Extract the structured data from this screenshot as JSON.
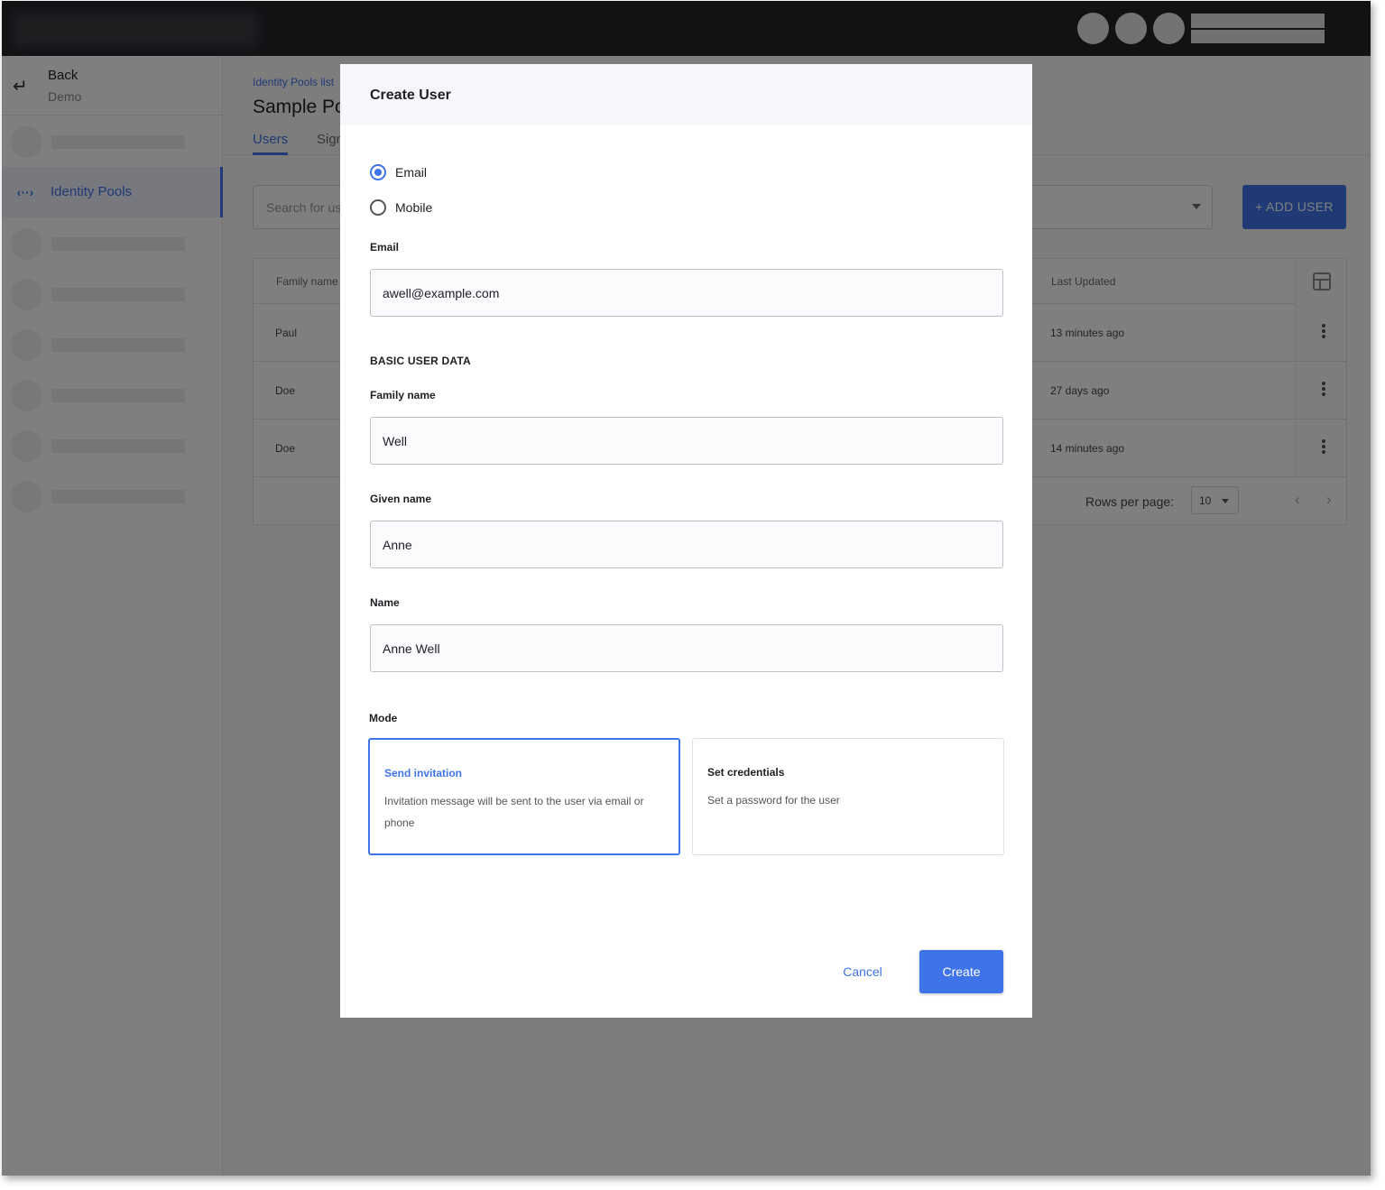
{
  "sidebar": {
    "back_label": "Back",
    "back_sub": "Demo",
    "active_item": "Identity Pools",
    "back_icon": "return-arrow-icon",
    "pool_icon": "identity-pools-icon"
  },
  "main": {
    "breadcrumb": "Identity Pools list",
    "title": "Sample Po",
    "tabs": [
      "Users",
      "Sign"
    ],
    "search_placeholder": "Search for us",
    "add_user_label": "+ ADD USER",
    "columns": [
      "Family name",
      "Last Updated"
    ],
    "rows": [
      {
        "family": "Paul",
        "updated": "13 minutes ago"
      },
      {
        "family": "Doe",
        "updated": "27 days ago"
      },
      {
        "family": "Doe",
        "updated": "14 minutes ago"
      }
    ],
    "rows_per_page_label": "Rows per page:",
    "rows_per_page_value": "10"
  },
  "modal": {
    "title": "Create User",
    "identifier_options": [
      "Email",
      "Mobile"
    ],
    "selected_identifier": "Email",
    "email_label": "Email",
    "email_value": "awell@example.com",
    "section_basic": "BASIC USER DATA",
    "family_name_label": "Family name",
    "family_name_value": "Well",
    "given_name_label": "Given name",
    "given_name_value": "Anne",
    "name_label": "Name",
    "name_value": "Anne Well",
    "mode_label": "Mode",
    "modes": [
      {
        "title": "Send invitation",
        "desc": "Invitation message will be sent to the user via email or phone"
      },
      {
        "title": "Set credentials",
        "desc": "Set a password for the user"
      }
    ],
    "selected_mode": "Send invitation",
    "cancel_label": "Cancel",
    "create_label": "Create"
  },
  "colors": {
    "accent": "#3f74e8",
    "topbar": "#25252b",
    "modal_header": "#f6f7fb"
  }
}
